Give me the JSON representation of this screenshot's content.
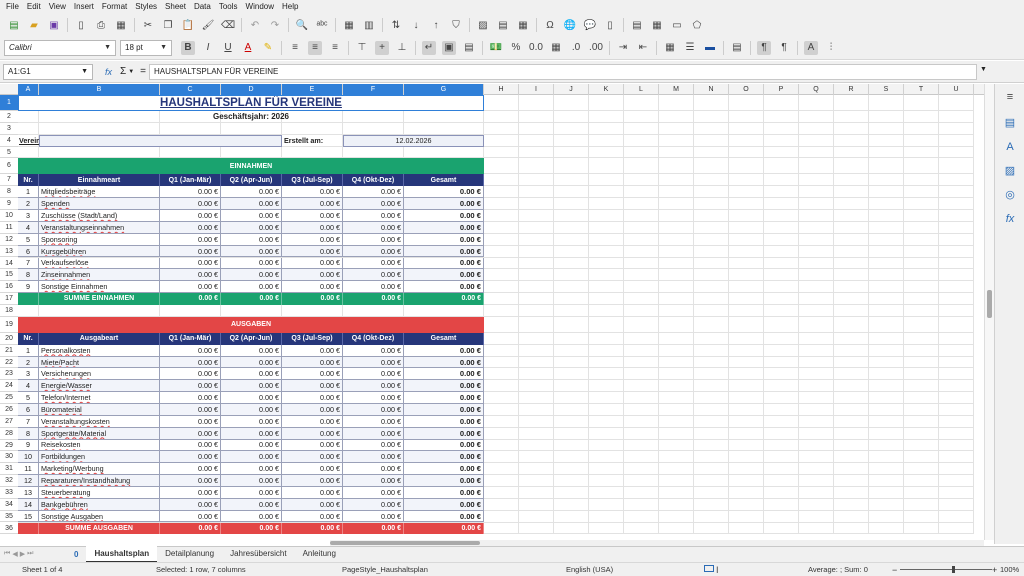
{
  "menu": [
    "File",
    "Edit",
    "View",
    "Insert",
    "Format",
    "Styles",
    "Sheet",
    "Data",
    "Tools",
    "Window",
    "Help"
  ],
  "toolbar": {
    "font_name": "Calibri",
    "font_size": "18 pt"
  },
  "formula_bar": {
    "name_box": "A1:G1",
    "fx": "fx",
    "sum": "Σ",
    "eq": "=",
    "content": "HAUSHALTSPLAN FÜR VEREINE"
  },
  "columns": [
    "A",
    "B",
    "C",
    "D",
    "E",
    "F",
    "G",
    "H",
    "I",
    "J",
    "K",
    "L",
    "M",
    "N",
    "O",
    "P",
    "Q",
    "R",
    "S",
    "T",
    "U"
  ],
  "sheet": {
    "title": "HAUSHALTSPLAN FÜR VEREINE",
    "fiscal_year_label": "Geschäftsjahr: 2026",
    "verein_label": "Verein",
    "created_label": "Erstellt am:",
    "created_date": "12.02.2026",
    "income_banner": "EINNAHMEN",
    "expense_banner": "AUSGABEN",
    "income_headers": [
      "Nr.",
      "Einnahmeart",
      "Q1 (Jan-Mär)",
      "Q2 (Apr-Jun)",
      "Q3 (Jul-Sep)",
      "Q4 (Okt-Dez)",
      "Gesamt"
    ],
    "expense_headers": [
      "Nr.",
      "Ausgabeart",
      "Q1 (Jan-Mär)",
      "Q2 (Apr-Jun)",
      "Q3 (Jul-Sep)",
      "Q4 (Okt-Dez)",
      "Gesamt"
    ],
    "zero": "0.00 €",
    "income_items": [
      "Mitgliedsbeiträge",
      "Spenden",
      "Zuschüsse (Stadt/Land)",
      "Veranstaltungseinnahmen",
      "Sponsoring",
      "Kursgebühren",
      "Verkaufserlöse",
      "Zinseinnahmen",
      "Sonstige Einnahmen"
    ],
    "expense_items": [
      "Personalkosten",
      "Miete/Pacht",
      "Versicherungen",
      "Energie/Wasser",
      "Telefon/Internet",
      "Büromaterial",
      "Veranstaltungskosten",
      "Sportgeräte/Material",
      "Reisekosten",
      "Fortbildungen",
      "Marketing/Werbung",
      "Reparaturen/Instandhaltung",
      "Steuerberatung",
      "Bankgebühren",
      "Sonstige Ausgaben"
    ],
    "income_sum_label": "SUMME EINNAHMEN",
    "expense_sum_label": "SUMME AUSGABEN"
  },
  "tabs": [
    "Haushaltsplan",
    "Detailplanung",
    "Jahresübersicht",
    "Anleitung"
  ],
  "tab_zero": "0",
  "status": {
    "sheet": "Sheet 1 of 4",
    "selection": "Selected: 1 row, 7 columns",
    "page_style": "PageStyle_Haushaltsplan",
    "language": "English (USA)",
    "summary": "Average: ; Sum: 0",
    "zoom": "100%"
  },
  "colors": {
    "income_green": "#1aa36f",
    "expense_red": "#e34646",
    "header_navy": "#26367a",
    "selection_blue": "#2f7fd8"
  }
}
